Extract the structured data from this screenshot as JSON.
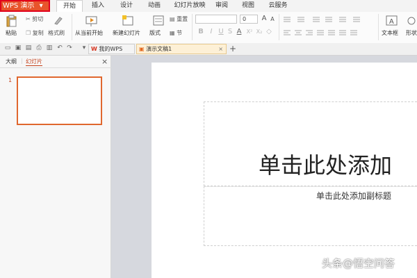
{
  "app": {
    "name": "WPS 演示",
    "dropdown_glyph": "▾",
    "accent": "#e8542b"
  },
  "menu": {
    "tabs": [
      "开始",
      "插入",
      "设计",
      "动画",
      "幻灯片放映",
      "审阅",
      "视图",
      "云服务"
    ],
    "active": "开始"
  },
  "ribbon": {
    "paste": "粘贴",
    "cut": "剪切",
    "copy": "复制",
    "format_painter": "格式刷",
    "from_current": "从当前开始",
    "new_slide": "新建幻灯片",
    "layout": "版式",
    "reset": "重置",
    "section": "节",
    "font_size": "0",
    "grow_font": "A",
    "shrink_font": "A",
    "bold": "B",
    "italic": "I",
    "underline": "U",
    "shadow": "S",
    "font_color": "A",
    "superscript": "X²",
    "subscript": "X₂",
    "clear": "◇",
    "textbox": "文本框",
    "shapes": "形状"
  },
  "quick_access": {
    "doc_tabs": [
      {
        "label": "我的WPS",
        "icon": "wps-logo-icon"
      },
      {
        "label": "演示文稿1",
        "icon": "presentation-file-icon"
      }
    ],
    "add_tab": "+"
  },
  "panel": {
    "tab_outline": "大纲",
    "tab_slides": "幻灯片",
    "close_glyph": "×",
    "slide_number": "1"
  },
  "slide": {
    "title_placeholder": "单击此处添加",
    "subtitle_placeholder": "单击此处添加副标题"
  },
  "watermark": "头条@悟空问答"
}
